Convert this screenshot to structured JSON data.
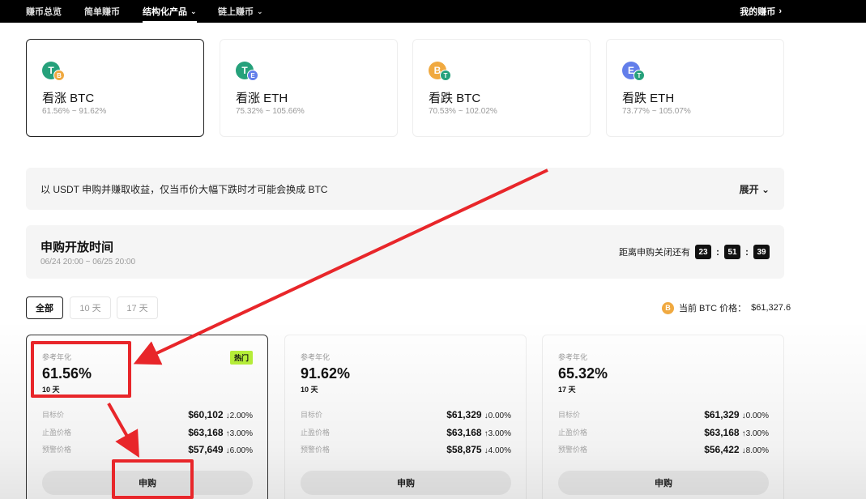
{
  "topnav": {
    "items": [
      {
        "label": "赚币总览",
        "active": false
      },
      {
        "label": "简单赚币",
        "active": false
      },
      {
        "label": "结构化产品",
        "active": true
      },
      {
        "label": "链上赚币",
        "active": false
      }
    ],
    "right_label": "我的赚币"
  },
  "products": [
    {
      "title": "看涨 BTC",
      "range": "61.56% ~ 91.62%",
      "main_coin": "T",
      "sub_coin": "B",
      "selected": true
    },
    {
      "title": "看涨 ETH",
      "range": "75.32% ~ 105.66%",
      "main_coin": "T",
      "sub_coin": "E",
      "selected": false
    },
    {
      "title": "看跌 BTC",
      "range": "70.53% ~ 102.02%",
      "main_coin": "B",
      "sub_coin": "T",
      "selected": false
    },
    {
      "title": "看跌 ETH",
      "range": "73.77% ~ 105.07%",
      "main_coin": "E",
      "sub_coin": "T",
      "selected": false
    }
  ],
  "banner": {
    "text": "以 USDT 申购并赚取收益，仅当币价大幅下跌时才可能会换成 BTC",
    "expand_label": "展开"
  },
  "subscription": {
    "title": "申购开放时间",
    "dates": "06/24 20:00 ~ 06/25 20:00",
    "countdown_label": "距离申购关闭还有",
    "hours": "23",
    "minutes": "51",
    "seconds": "39"
  },
  "filters": {
    "items": [
      "全部",
      "10 天",
      "17 天"
    ],
    "active_index": 0
  },
  "current_price": {
    "label": "当前 BTC 价格：",
    "value": "$61,327.6"
  },
  "offers": [
    {
      "apy_label": "参考年化",
      "apy": "61.56%",
      "days": "10 天",
      "hot": "热门",
      "rows": [
        {
          "label": "目标价",
          "price": "$60,102",
          "dir": "↓",
          "pct": "2.00%"
        },
        {
          "label": "止盈价格",
          "price": "$63,168",
          "dir": "↑",
          "pct": "3.00%"
        },
        {
          "label": "预警价格",
          "price": "$57,649",
          "dir": "↓",
          "pct": "6.00%"
        }
      ],
      "button": "申购"
    },
    {
      "apy_label": "参考年化",
      "apy": "91.62%",
      "days": "10 天",
      "hot": "",
      "rows": [
        {
          "label": "目标价",
          "price": "$61,329",
          "dir": "↓",
          "pct": "0.00%"
        },
        {
          "label": "止盈价格",
          "price": "$63,168",
          "dir": "↑",
          "pct": "3.00%"
        },
        {
          "label": "预警价格",
          "price": "$58,875",
          "dir": "↓",
          "pct": "4.00%"
        }
      ],
      "button": "申购"
    },
    {
      "apy_label": "参考年化",
      "apy": "65.32%",
      "days": "17 天",
      "hot": "",
      "rows": [
        {
          "label": "目标价",
          "price": "$61,329",
          "dir": "↓",
          "pct": "0.00%"
        },
        {
          "label": "止盈价格",
          "price": "$63,168",
          "dir": "↑",
          "pct": "3.00%"
        },
        {
          "label": "预警价格",
          "price": "$56,422",
          "dir": "↓",
          "pct": "8.00%"
        }
      ],
      "button": "申购"
    }
  ],
  "colors": {
    "tether": "#26a17b",
    "bitcoin": "#f0a940",
    "ethereum": "#627eea",
    "hot_badge": "#b8f03a",
    "annotation": "#e8262a"
  }
}
